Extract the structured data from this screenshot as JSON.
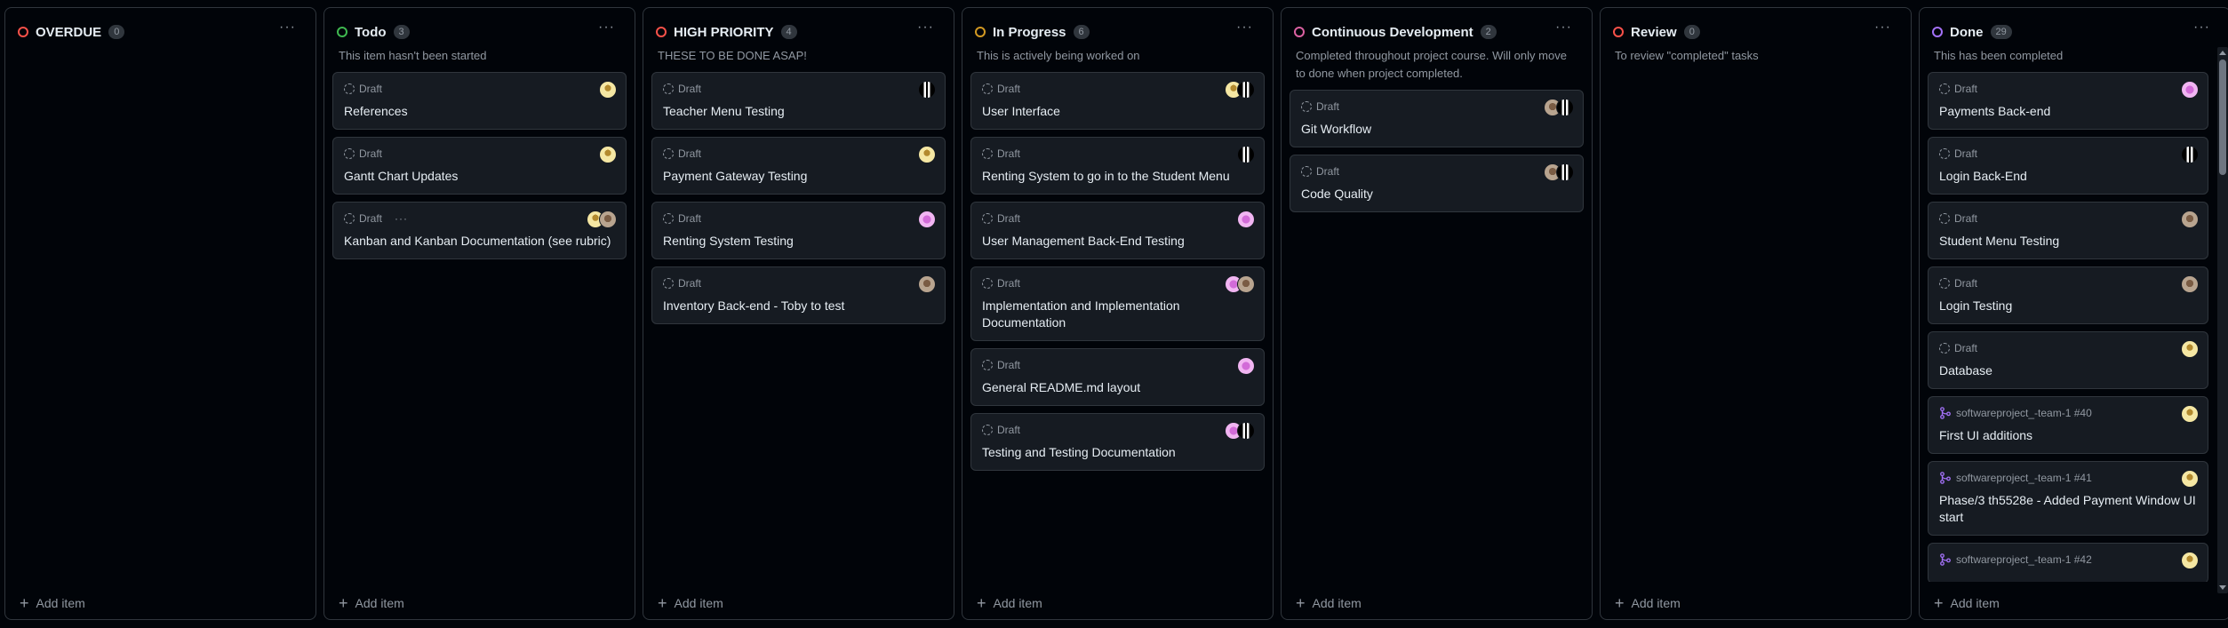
{
  "columns": [
    {
      "title": "OVERDUE",
      "count": "0",
      "description": "",
      "status_color": "#f85149",
      "cards": [],
      "add_label": "Add item"
    },
    {
      "title": "Todo",
      "count": "3",
      "description": "This item hasn't been started",
      "status_color": "#3fb950",
      "cards": [
        {
          "meta": "Draft",
          "title": "References",
          "avatars": [
            "yellow"
          ]
        },
        {
          "meta": "Draft",
          "title": "Gantt Chart Updates",
          "avatars": [
            "yellow"
          ]
        },
        {
          "meta": "Draft",
          "title": "Kanban and Kanban Documentation (see rubric)",
          "avatars": [
            "yellow",
            "photo"
          ],
          "has_dots": true
        }
      ],
      "add_label": "Add item"
    },
    {
      "title": "HIGH PRIORITY",
      "count": "4",
      "description": "THESE TO BE DONE ASAP!",
      "status_color": "#f85149",
      "cards": [
        {
          "meta": "Draft",
          "title": "Teacher Menu Testing",
          "avatars": [
            "bw"
          ]
        },
        {
          "meta": "Draft",
          "title": "Payment Gateway Testing",
          "avatars": [
            "yellow"
          ]
        },
        {
          "meta": "Draft",
          "title": "Renting System Testing",
          "avatars": [
            "pink"
          ]
        },
        {
          "meta": "Draft",
          "title": "Inventory Back-end - Toby to test",
          "avatars": [
            "photo"
          ]
        }
      ],
      "add_label": "Add item"
    },
    {
      "title": "In Progress",
      "count": "6",
      "description": "This is actively being worked on",
      "status_color": "#d29922",
      "cards": [
        {
          "meta": "Draft",
          "title": "User Interface",
          "avatars": [
            "yellow",
            "bw"
          ]
        },
        {
          "meta": "Draft",
          "title": "Renting System to go in to the Student Menu",
          "avatars": [
            "bw"
          ]
        },
        {
          "meta": "Draft",
          "title": "User Management Back-End Testing",
          "avatars": [
            "pink"
          ]
        },
        {
          "meta": "Draft",
          "title": "Implementation and Implementation Documentation",
          "avatars": [
            "pink",
            "photo"
          ]
        },
        {
          "meta": "Draft",
          "title": "General README.md layout",
          "avatars": [
            "pink"
          ]
        },
        {
          "meta": "Draft",
          "title": "Testing and Testing Documentation",
          "avatars": [
            "pink",
            "bw"
          ]
        }
      ],
      "add_label": "Add item"
    },
    {
      "title": "Continuous Development",
      "count": "2",
      "description": "Completed throughout project course. Will only move to done when project completed.",
      "status_color": "#db61a2",
      "cards": [
        {
          "meta": "Draft",
          "title": "Git Workflow",
          "avatars": [
            "photo",
            "bw"
          ]
        },
        {
          "meta": "Draft",
          "title": "Code Quality",
          "avatars": [
            "photo",
            "bw"
          ]
        }
      ],
      "add_label": "Add item"
    },
    {
      "title": "Review",
      "count": "0",
      "description": "To review \"completed\" tasks",
      "status_color": "#f85149",
      "cards": [],
      "add_label": "Add item"
    },
    {
      "title": "Done",
      "count": "29",
      "description": "This has been completed",
      "status_color": "#a371f7",
      "cards": [
        {
          "meta": "Draft",
          "title": "Payments Back-end",
          "avatars": [
            "pink"
          ]
        },
        {
          "meta": "Draft",
          "title": "Login Back-End",
          "avatars": [
            "bw"
          ]
        },
        {
          "meta": "Draft",
          "title": "Student Menu Testing",
          "avatars": [
            "photo"
          ]
        },
        {
          "meta": "Draft",
          "title": "Login Testing",
          "avatars": [
            "photo"
          ]
        },
        {
          "meta": "Draft",
          "title": "Database",
          "avatars": [
            "yellow"
          ]
        },
        {
          "meta": "softwareproject_-team-1 #40",
          "title": "First UI additions",
          "avatars": [
            "yellow"
          ],
          "is_pr": true
        },
        {
          "meta": "softwareproject_-team-1 #41",
          "title": "Phase/3 th5528e - Added Payment Window UI start",
          "avatars": [
            "yellow"
          ],
          "is_pr": true
        },
        {
          "meta": "softwareproject_-team-1 #42",
          "title": "",
          "avatars": [
            "yellow"
          ],
          "is_pr": true
        }
      ],
      "add_label": "Add item"
    }
  ]
}
